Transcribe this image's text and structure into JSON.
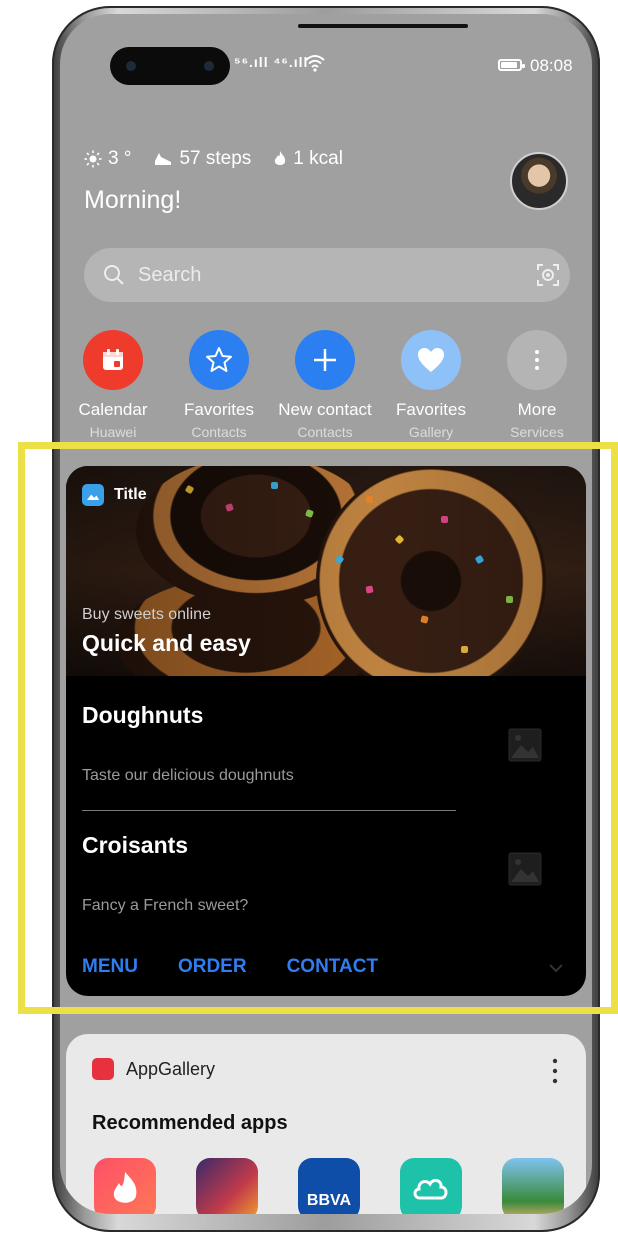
{
  "status_bar": {
    "signal": "⁵⁶.ıll ⁴⁶.ıll",
    "time": "08:08"
  },
  "info": {
    "weather": "3 °",
    "steps": "57 steps",
    "kcal": "1 kcal",
    "greeting": "Morning!"
  },
  "search": {
    "placeholder": "Search"
  },
  "shortcuts": [
    {
      "label": "Calendar",
      "sub": "Huawei",
      "color": "#ef3b2c"
    },
    {
      "label": "Favorites",
      "sub": "Contacts",
      "color": "#2b7ff0"
    },
    {
      "label": "New contact",
      "sub": "Contacts",
      "color": "#2b7ff0"
    },
    {
      "label": "Favorites",
      "sub": "Gallery",
      "color": "#8ec1f7"
    },
    {
      "label": "More",
      "sub": "Services",
      "color": "#b4b4b4"
    }
  ],
  "widget": {
    "title": "Title",
    "hero_sub": "Buy sweets online",
    "hero_main": "Quick and easy",
    "items": [
      {
        "title": "Doughnuts",
        "desc": "Taste our delicious doughnuts"
      },
      {
        "title": "Croisants",
        "desc": "Fancy a French sweet?"
      }
    ],
    "actions": [
      "MENU",
      "ORDER",
      "CONTACT"
    ],
    "accent": "#2f7df0",
    "highlight_color": "#ece047"
  },
  "gallery": {
    "name": "AppGallery",
    "title": "Recommended apps",
    "apps": [
      {
        "icon": "tinder-app-icon"
      },
      {
        "icon": "game-app-icon"
      },
      {
        "icon": "bbva-app-icon",
        "label": "BBVA"
      },
      {
        "icon": "cloud-app-icon"
      },
      {
        "icon": "rise-of-kingdoms-app-icon"
      }
    ]
  }
}
